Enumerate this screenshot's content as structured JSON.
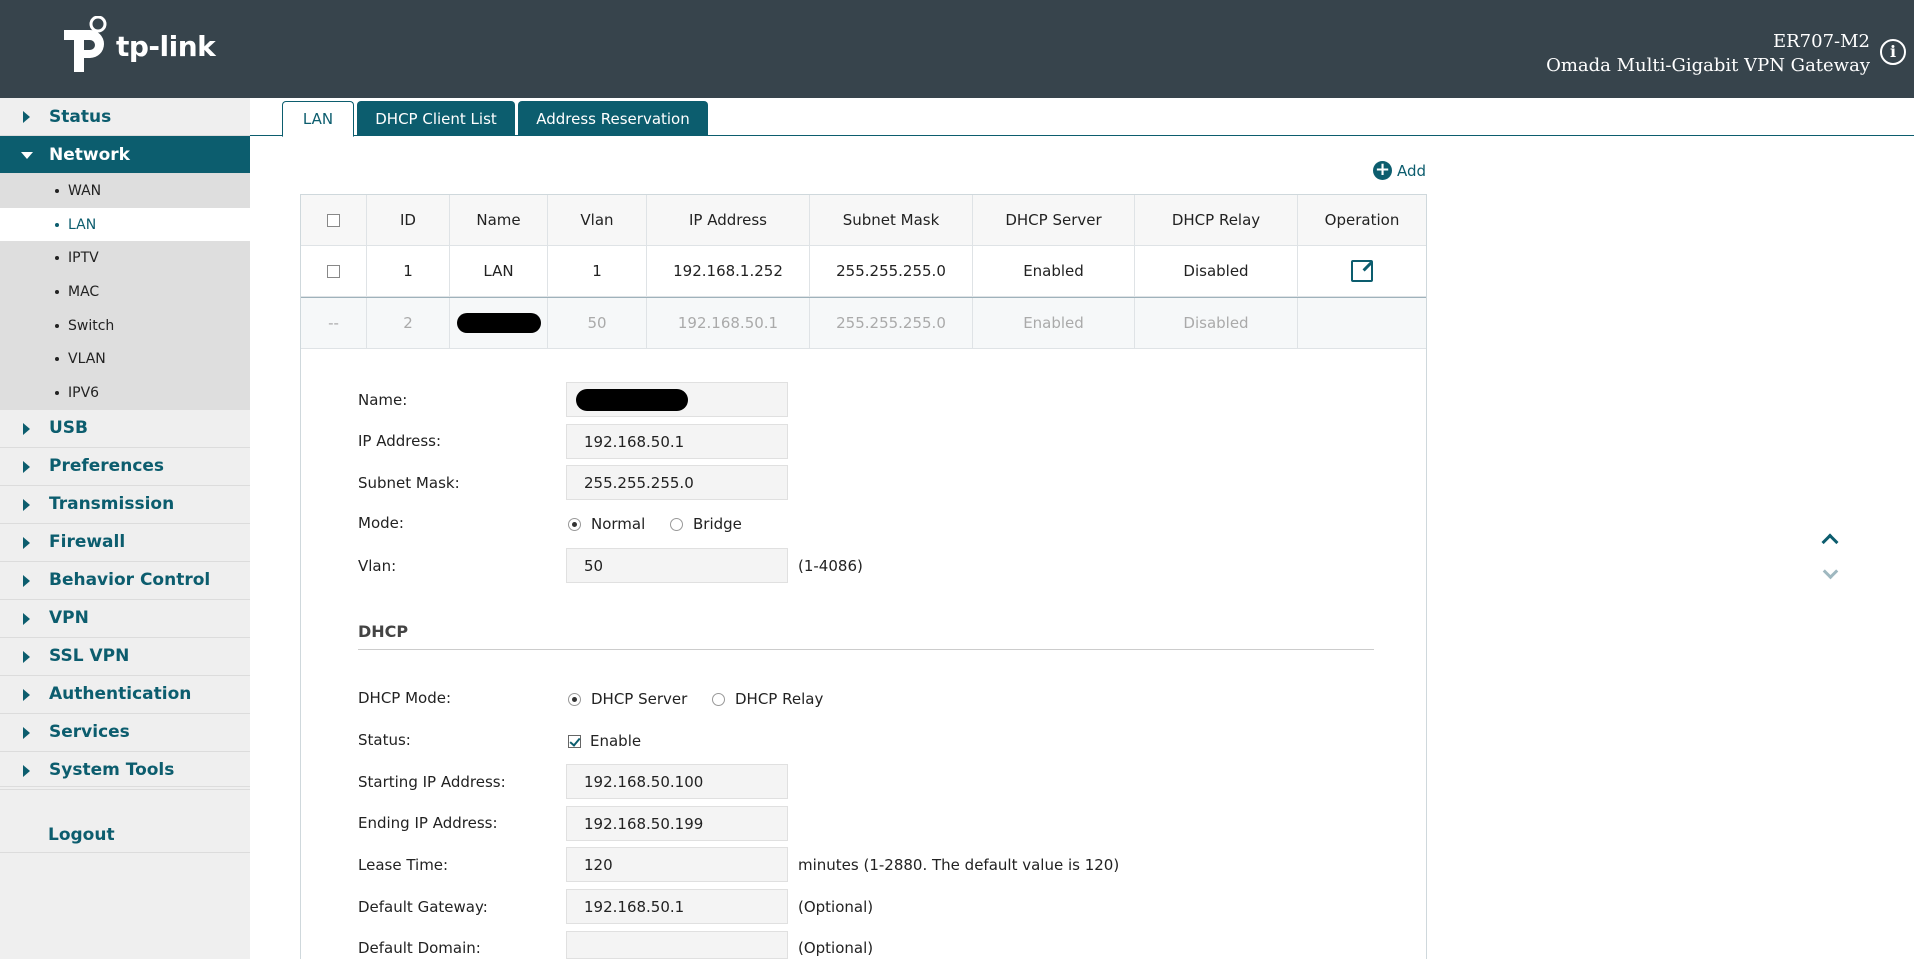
{
  "header": {
    "brand": "tp-link",
    "model": "ER707-M2",
    "product": "Omada Multi-Gigabit VPN Gateway",
    "info_glyph": "i"
  },
  "sidebar": {
    "items": [
      {
        "label": "Status"
      },
      {
        "label": "Network",
        "expanded": true,
        "children": [
          "WAN",
          "LAN",
          "IPTV",
          "MAC",
          "Switch",
          "VLAN",
          "IPV6"
        ],
        "selected_child": "LAN"
      },
      {
        "label": "USB"
      },
      {
        "label": "Preferences"
      },
      {
        "label": "Transmission"
      },
      {
        "label": "Firewall"
      },
      {
        "label": "Behavior Control"
      },
      {
        "label": "VPN"
      },
      {
        "label": "SSL VPN"
      },
      {
        "label": "Authentication"
      },
      {
        "label": "Services"
      },
      {
        "label": "System Tools"
      }
    ],
    "logout": "Logout"
  },
  "tabs": [
    "LAN",
    "DHCP Client List",
    "Address Reservation"
  ],
  "add_label": "Add",
  "table": {
    "headers": [
      "ID",
      "Name",
      "Vlan",
      "IP Address",
      "Subnet Mask",
      "DHCP Server",
      "DHCP Relay",
      "Operation"
    ],
    "rows": [
      {
        "select": "",
        "id": "1",
        "name": "LAN",
        "vlan": "1",
        "ip": "192.168.1.252",
        "mask": "255.255.255.0",
        "dhcp_server": "Enabled",
        "dhcp_relay": "Disabled"
      },
      {
        "select": "--",
        "id": "2",
        "name": "",
        "vlan": "50",
        "ip": "192.168.50.1",
        "mask": "255.255.255.0",
        "dhcp_server": "Enabled",
        "dhcp_relay": "Disabled"
      }
    ]
  },
  "form": {
    "name_label": "Name:",
    "ip_label": "IP Address:",
    "ip_value": "192.168.50.1",
    "mask_label": "Subnet Mask:",
    "mask_value": "255.255.255.0",
    "mode_label": "Mode:",
    "mode_normal": "Normal",
    "mode_bridge": "Bridge",
    "vlan_label": "Vlan:",
    "vlan_value": "50",
    "vlan_hint": "(1-4086)",
    "dhcp_title": "DHCP",
    "dhcp_mode_label": "DHCP Mode:",
    "dhcp_server": "DHCP Server",
    "dhcp_relay": "DHCP Relay",
    "status_label": "Status:",
    "status_enable": "Enable",
    "start_label": "Starting IP Address:",
    "start_value": "192.168.50.100",
    "end_label": "Ending IP Address:",
    "end_value": "192.168.50.199",
    "lease_label": "Lease Time:",
    "lease_value": "120",
    "lease_hint": "minutes (1-2880. The default value is 120)",
    "gateway_label": "Default Gateway:",
    "gateway_value": "192.168.50.1",
    "gateway_hint": "(Optional)",
    "domain_label": "Default Domain:",
    "domain_value": "",
    "domain_hint": "(Optional)"
  }
}
